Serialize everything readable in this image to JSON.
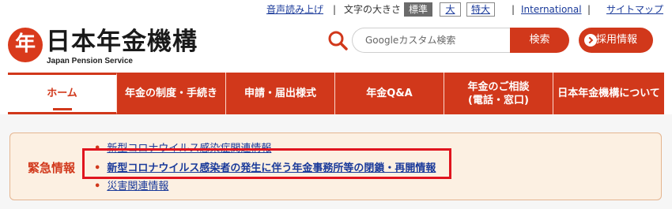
{
  "utility": {
    "read_aloud": "音声読み上げ",
    "sep": "|",
    "font_size_label": "文字の大きさ",
    "font_sizes": [
      "標準",
      "大",
      "特大"
    ],
    "international": "International",
    "sitemap": "サイトマップ"
  },
  "header": {
    "logo_mark": "年",
    "title": "日本年金機構",
    "subtitle": "Japan Pension Service",
    "search_placeholder": "Googleカスタム検索",
    "search_button": "検索",
    "recruit_button": "採用情報"
  },
  "nav": {
    "items": [
      "ホーム",
      "年金の制度・手続き",
      "申請・届出様式",
      "年金Q&A",
      "年金のご相談\n(電話・窓口)",
      "日本年金機構について"
    ]
  },
  "emergency": {
    "label": "緊急情報",
    "items": [
      "新型コロナウイルス感染症関連情報",
      "新型コロナウイルス感染者の発生に伴う年金事務所等の閉鎖・再開情報",
      "災害関連情報"
    ]
  },
  "colors": {
    "accent": "#d1381b",
    "link": "#1a3a9a",
    "highlight": "#e0141e",
    "emergency_bg": "#fcf0e2"
  }
}
